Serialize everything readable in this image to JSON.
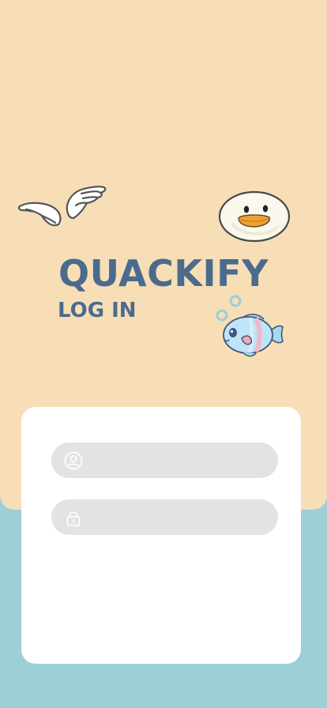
{
  "app": {
    "title": "QUACKIFY",
    "subtitle": "LOG IN"
  },
  "decorations": {
    "wings": "wings-illustration",
    "duck": "duck-face-illustration",
    "fish": "fish-illustration"
  },
  "login_form": {
    "username": {
      "icon": "user-icon",
      "value": "",
      "placeholder": ""
    },
    "password": {
      "icon": "lock-icon",
      "value": "",
      "placeholder": ""
    }
  },
  "colors": {
    "top_background": "#f7deb6",
    "bottom_background": "#9ccfd6",
    "title_text": "#4a6b8e",
    "card_background": "#ffffff",
    "field_background": "#e5e2e2"
  }
}
